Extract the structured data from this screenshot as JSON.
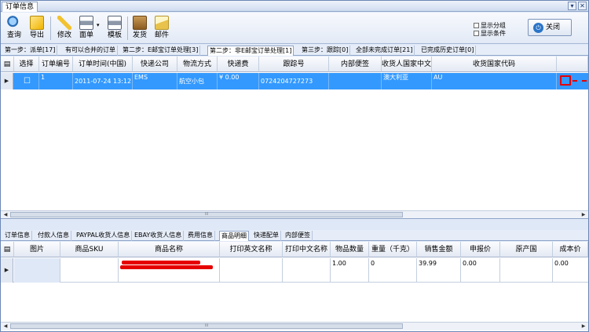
{
  "window": {
    "title": "订单信息"
  },
  "toolbar": {
    "buttons": [
      {
        "label": "查询"
      },
      {
        "label": "导出"
      },
      {
        "label": "修改"
      },
      {
        "label": "面单"
      },
      {
        "label": "模板"
      },
      {
        "label": "发货"
      },
      {
        "label": "邮件"
      }
    ],
    "checkboxes": [
      {
        "label": "显示分组"
      },
      {
        "label": "显示条件"
      }
    ],
    "close_label": "关闭"
  },
  "status_tabs": [
    {
      "label": "第一步：派单[17]"
    },
    {
      "label": "有可以合并的订单"
    },
    {
      "label": "第二步：E邮宝订单处理[3]"
    },
    {
      "label": "第二步：非E邮宝订单处理[1]"
    },
    {
      "label": "第三步：跟踪[0]"
    },
    {
      "label": "全部未完成订单[21]"
    },
    {
      "label": "已完成历史订单[0]"
    }
  ],
  "orders_table": {
    "columns": [
      "选择",
      "订单编号",
      "订单时间(中国)",
      "快递公司",
      "物流方式",
      "快递费",
      "跟踪号",
      "内部便签",
      "收货人国家中文",
      "收货国家代码"
    ],
    "rows": [
      {
        "select": "☐",
        "order_no": "1",
        "order_time": "2011-07-24 13:12:32",
        "courier": "EMS",
        "shipping": "航空小包",
        "fee": "¥ 0.00",
        "tracking": "0724204727273",
        "note": "",
        "country_cn": "澳大利亚",
        "country_code": "AU"
      }
    ]
  },
  "detail_tabs": [
    {
      "label": "订单信息"
    },
    {
      "label": "付款人信息"
    },
    {
      "label": "PAYPAL收货人信息"
    },
    {
      "label": "EBAY收货人信息"
    },
    {
      "label": "费用信息"
    },
    {
      "label": "商品明细"
    },
    {
      "label": "快递配单"
    },
    {
      "label": "内部便签"
    }
  ],
  "items_table": {
    "columns": [
      "图片",
      "商品SKU",
      "商品名称",
      "打印英文名称",
      "打印中文名称",
      "物品数量",
      "重量（千克）",
      "销售金额",
      "申报价",
      "原产国",
      "成本价"
    ],
    "rows": [
      {
        "image": "",
        "sku": "",
        "name": "",
        "print_en": "",
        "print_cn": "",
        "qty": "1.00",
        "weight": "0",
        "amount": "39.99",
        "declared": "0.00",
        "origin": "",
        "cost": "0.00"
      }
    ]
  },
  "colors": {
    "selection": "#3399ff",
    "header_bg": "#dfe8f6",
    "redaction": "#e60000"
  }
}
